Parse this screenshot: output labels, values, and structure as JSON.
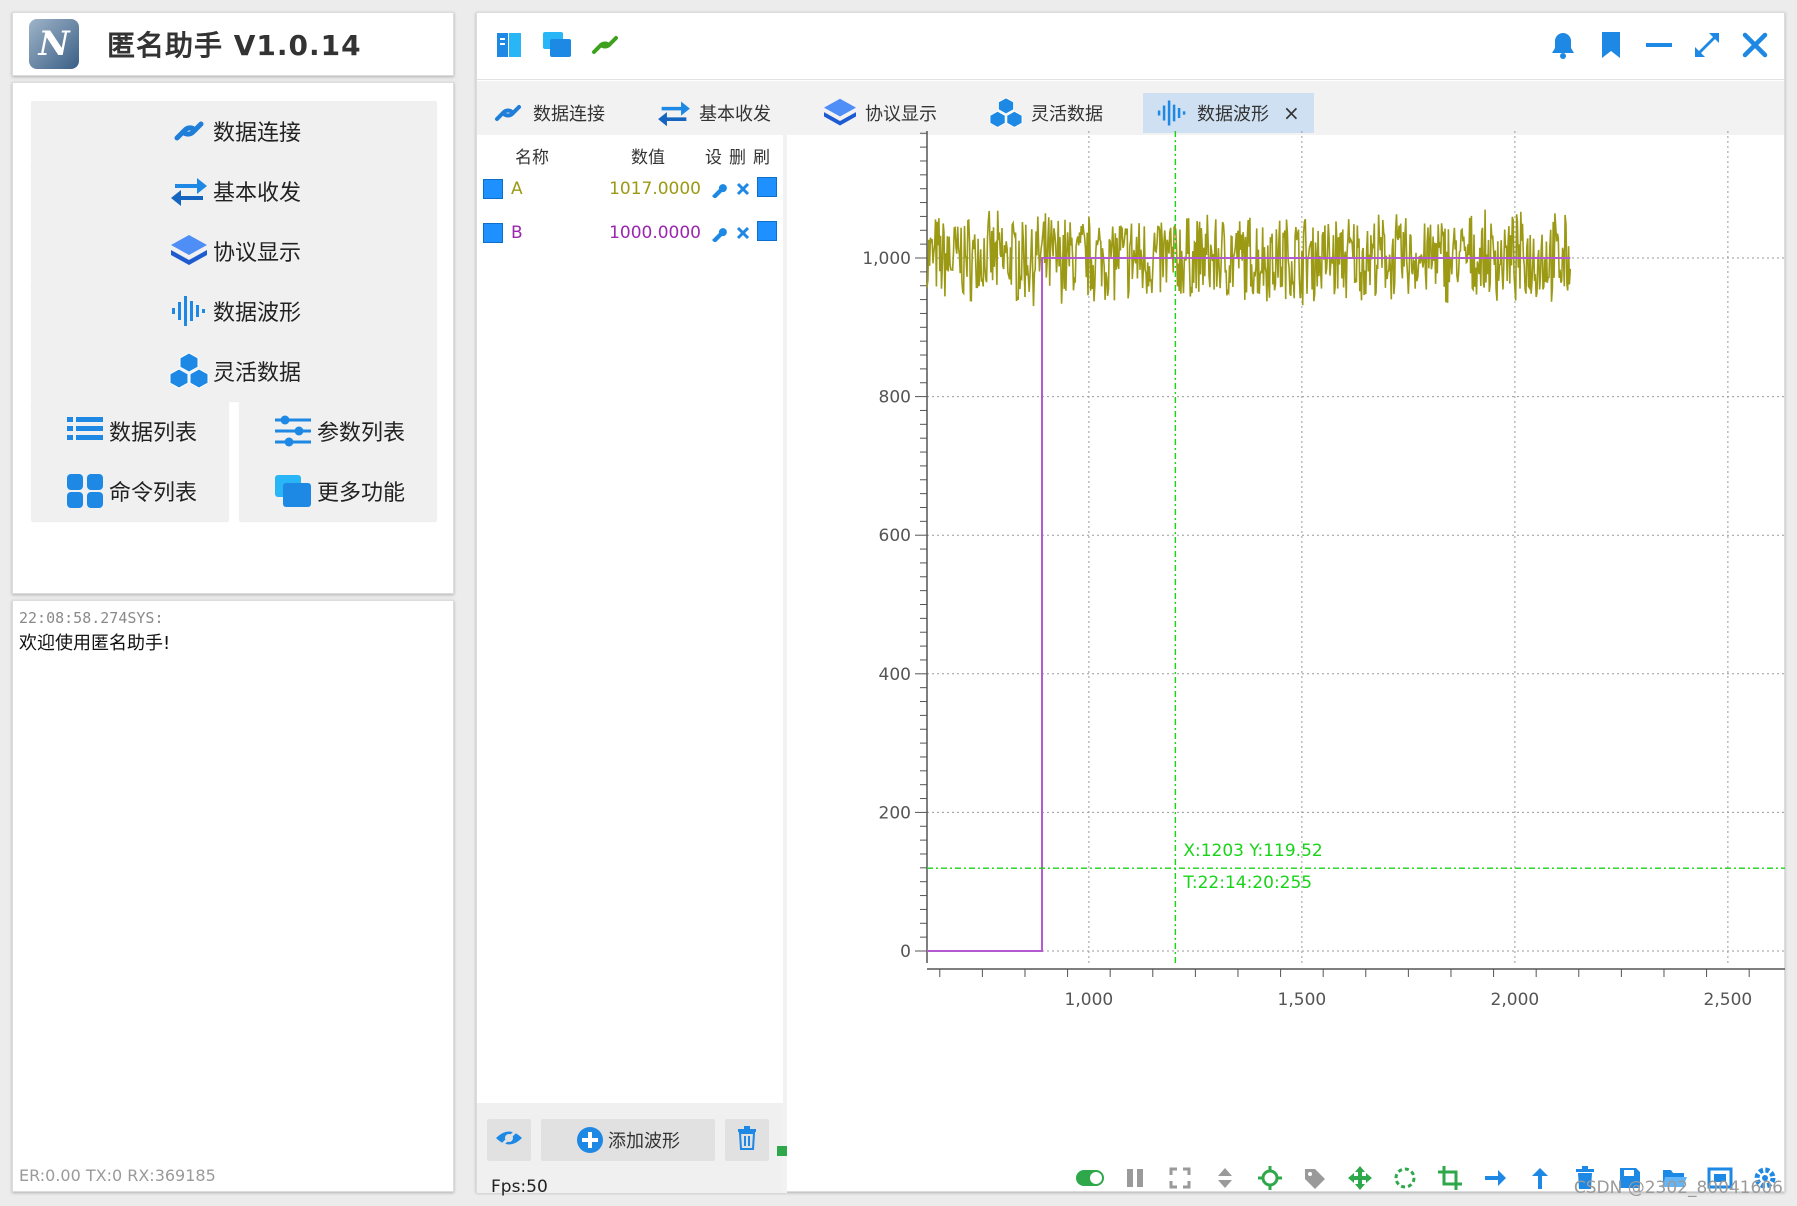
{
  "app": {
    "title": "匿名助手   V1.0.14",
    "logo_letter": "N"
  },
  "nav": {
    "data_connect": "数据连接",
    "basic_txrx": "基本收发",
    "protocol_display": "协议显示",
    "data_waveform": "数据波形",
    "flexible_data": "灵活数据",
    "data_list": "数据列表",
    "param_list": "参数列表",
    "command_list": "命令列表",
    "more_functions": "更多功能"
  },
  "log": {
    "time": "22:08:58.274SYS:",
    "message": "欢迎使用匿名助手!",
    "stats": "ER:0.00 TX:0 RX:369185"
  },
  "toolbar": {
    "icons": [
      "book-icon",
      "windows-icon",
      "link-icon"
    ],
    "window_icons": [
      "bell-icon",
      "bookmark-icon",
      "minimize-icon",
      "maximize-icon",
      "close-icon"
    ]
  },
  "tabs": [
    {
      "label": "数据连接",
      "icon": "link-icon"
    },
    {
      "label": "基本收发",
      "icon": "swap-icon"
    },
    {
      "label": "协议显示",
      "icon": "layers-icon"
    },
    {
      "label": "灵活数据",
      "icon": "cubes-icon"
    },
    {
      "label": "数据波形",
      "icon": "waveform-icon",
      "active": true,
      "close": "×"
    }
  ],
  "wave_table": {
    "headers": {
      "name": "名称",
      "value": "数值",
      "set": "设",
      "del": "删",
      "refresh": "刷"
    },
    "rows": [
      {
        "name": "A",
        "value": "1017.0000",
        "color": "#9c9a14"
      },
      {
        "name": "B",
        "value": "1000.0000",
        "color": "#9b27b0"
      }
    ]
  },
  "bottom_bar": {
    "add_waveform": "添加波形",
    "fps": "Fps:50"
  },
  "chart_data": {
    "type": "line",
    "x_ticks": [
      "1,000",
      "1,500",
      "2,000",
      "2,500"
    ],
    "y_ticks": [
      "0",
      "200",
      "400",
      "600",
      "800",
      "1,000"
    ],
    "xlim": [
      610,
      2960
    ],
    "ylim": [
      -20,
      1180
    ],
    "series": [
      {
        "name": "A",
        "color": "#9c9a14",
        "x_range": [
          620,
          2130
        ],
        "mean": 1000,
        "noise": 50
      },
      {
        "name": "B",
        "color": "#b45ad0",
        "points": [
          [
            620,
            0
          ],
          [
            890,
            0
          ],
          [
            890,
            1000
          ],
          [
            2130,
            1000
          ]
        ]
      }
    ],
    "cursor": {
      "x": 1203,
      "y": 119.52,
      "label1": "X:1203 Y:119.52",
      "label2": "T:22:14:20:255",
      "color": "#18d418"
    },
    "grid": true
  },
  "watermark": "CSDN @2302_80041606"
}
